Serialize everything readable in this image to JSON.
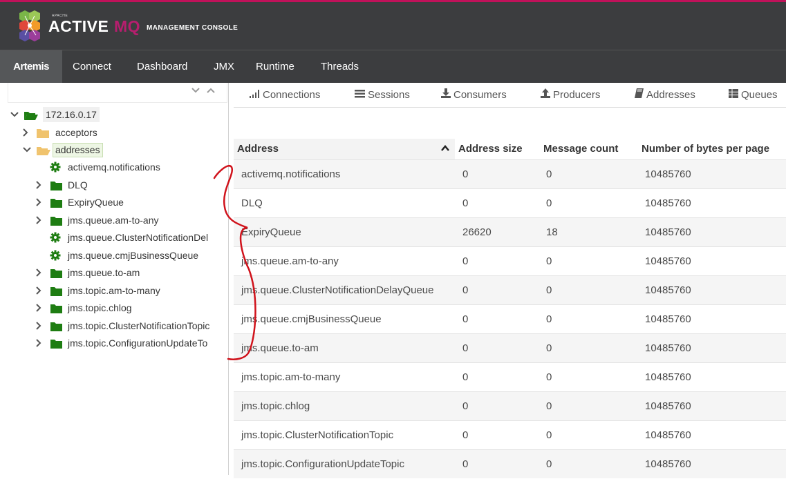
{
  "branding": {
    "apache": "APACHE",
    "active": "ACTIVE",
    "mq": "MQ",
    "console": "MANAGEMENT CONSOLE"
  },
  "nav": {
    "items": [
      {
        "label": "Artemis",
        "active": true
      },
      {
        "label": "Connect"
      },
      {
        "label": "Dashboard"
      },
      {
        "label": "JMX"
      },
      {
        "label": "Runtime"
      },
      {
        "label": "Threads"
      }
    ]
  },
  "tree": {
    "root": "172.16.0.17",
    "acceptors": "acceptors",
    "addresses": "addresses",
    "children": [
      {
        "label": "activemq.notifications",
        "icon": "gear-icon",
        "expandable": false
      },
      {
        "label": "DLQ",
        "icon": "folder-icon",
        "expandable": true
      },
      {
        "label": "ExpiryQueue",
        "icon": "folder-icon",
        "expandable": true
      },
      {
        "label": "jms.queue.am-to-any",
        "icon": "folder-icon",
        "expandable": true
      },
      {
        "label": "jms.queue.ClusterNotificationDel",
        "icon": "gear-icon",
        "expandable": false
      },
      {
        "label": "jms.queue.cmjBusinessQueue",
        "icon": "gear-icon",
        "expandable": false
      },
      {
        "label": "jms.queue.to-am",
        "icon": "folder-icon",
        "expandable": true
      },
      {
        "label": "jms.topic.am-to-many",
        "icon": "folder-icon",
        "expandable": true
      },
      {
        "label": "jms.topic.chlog",
        "icon": "folder-icon",
        "expandable": true
      },
      {
        "label": "jms.topic.ClusterNotificationTopic",
        "icon": "folder-icon",
        "expandable": true
      },
      {
        "label": "jms.topic.ConfigurationUpdateTo",
        "icon": "folder-icon",
        "expandable": true
      }
    ]
  },
  "subtabs": [
    {
      "label": "Connections",
      "icon": "bar-chart-icon"
    },
    {
      "label": "Sessions",
      "icon": "list-icon"
    },
    {
      "label": "Consumers",
      "icon": "download-icon"
    },
    {
      "label": "Producers",
      "icon": "upload-icon"
    },
    {
      "label": "Addresses",
      "icon": "book-icon"
    },
    {
      "label": "Queues",
      "icon": "table-icon"
    }
  ],
  "table": {
    "columns": [
      "Address",
      "Address size",
      "Message count",
      "Number of bytes per page"
    ],
    "rows": [
      [
        "activemq.notifications",
        "0",
        "0",
        "10485760"
      ],
      [
        "DLQ",
        "0",
        "0",
        "10485760"
      ],
      [
        "ExpiryQueue",
        "26620",
        "18",
        "10485760"
      ],
      [
        "jms.queue.am-to-any",
        "0",
        "0",
        "10485760"
      ],
      [
        "jms.queue.ClusterNotificationDelayQueue",
        "0",
        "0",
        "10485760"
      ],
      [
        "jms.queue.cmjBusinessQueue",
        "0",
        "0",
        "10485760"
      ],
      [
        "jms.queue.to-am",
        "0",
        "0",
        "10485760"
      ],
      [
        "jms.topic.am-to-many",
        "0",
        "0",
        "10485760"
      ],
      [
        "jms.topic.chlog",
        "0",
        "0",
        "10485760"
      ],
      [
        "jms.topic.ClusterNotificationTopic",
        "0",
        "0",
        "10485760"
      ],
      [
        "jms.topic.ConfigurationUpdateTopic",
        "0",
        "0",
        "10485760"
      ]
    ]
  },
  "colors": {
    "accent_line": "#c0125a",
    "header_bg": "#3c3d3f",
    "mq_magenta": "#b61e6e",
    "folder_green": "#1e7d12",
    "folder_tan": "#f0c36d",
    "annotation_red": "#d0121b"
  }
}
